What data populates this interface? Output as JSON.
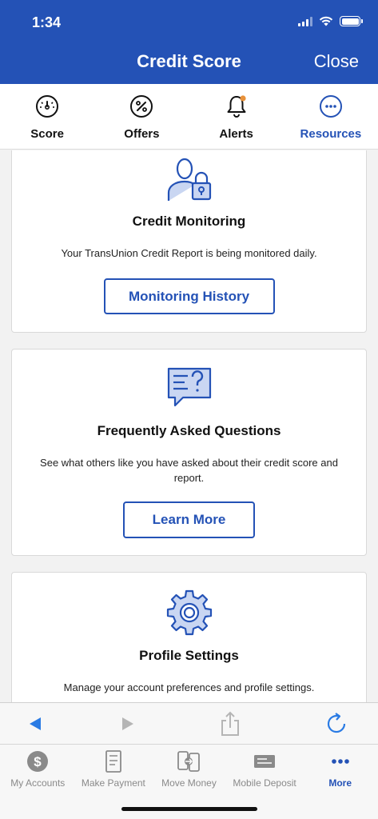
{
  "status_bar": {
    "time": "1:34"
  },
  "header": {
    "title": "Credit Score",
    "close_label": "Close"
  },
  "tabs": [
    {
      "label": "Score",
      "icon": "speedometer-icon",
      "active": false
    },
    {
      "label": "Offers",
      "icon": "percent-icon",
      "active": false
    },
    {
      "label": "Alerts",
      "icon": "bell-icon",
      "active": false
    },
    {
      "label": "Resources",
      "icon": "ellipsis-circle-icon",
      "active": true
    }
  ],
  "cards": {
    "monitoring": {
      "icon": "user-lock-icon",
      "title": "Credit Monitoring",
      "description": "Your TransUnion Credit Report is being monitored daily.",
      "button_label": "Monitoring History"
    },
    "faq": {
      "icon": "question-document-icon",
      "title": "Frequently Asked Questions",
      "description": "See what others like you have asked about their credit score and report.",
      "button_label": "Learn More"
    },
    "profile": {
      "icon": "gear-icon",
      "title": "Profile Settings",
      "description": "Manage your account preferences and profile settings."
    }
  },
  "bottom_nav": [
    {
      "label": "My Accounts",
      "icon": "dollar-circle-icon",
      "active": false
    },
    {
      "label": "Make Payment",
      "icon": "bill-icon",
      "active": false
    },
    {
      "label": "Move Money",
      "icon": "transfer-icon",
      "active": false
    },
    {
      "label": "Mobile Deposit",
      "icon": "check-deposit-icon",
      "active": false
    },
    {
      "label": "More",
      "icon": "more-dots-icon",
      "active": true
    }
  ],
  "colors": {
    "brand_blue": "#2452b6",
    "accent_orange": "#e8913a",
    "background": "#f2f2f2"
  }
}
